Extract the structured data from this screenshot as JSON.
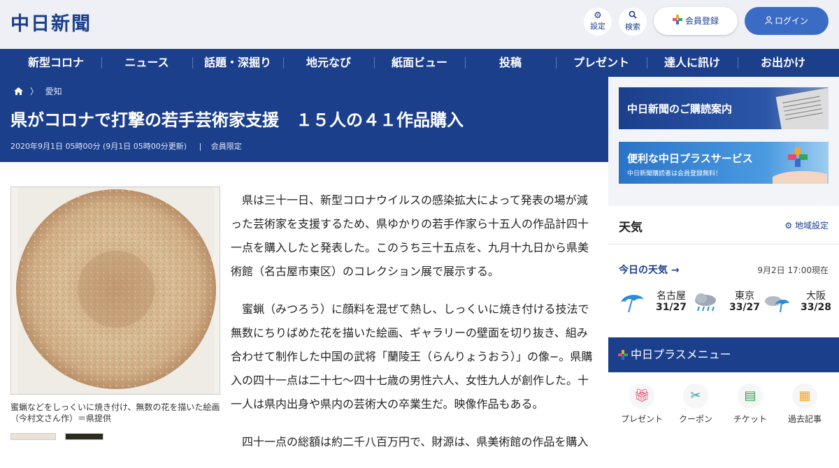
{
  "header": {
    "logo": "中日新聞",
    "settings_label": "設定",
    "search_label": "検索",
    "member_label": "会員登録",
    "login_label": "ログイン"
  },
  "nav": [
    "新型コロナ",
    "ニュース",
    "話題・深掘り",
    "地元なび",
    "紙面ビュー",
    "投稿",
    "プレゼント",
    "達人に訊け",
    "お出かけ"
  ],
  "breadcrumb": {
    "sep": "〉",
    "category": "愛知"
  },
  "article": {
    "title": "県がコロナで打撃の若手芸術家支援　１５人の４１作品購入",
    "date": "2020年9月1日 05時00分 (9月1日 05時00分更新)",
    "divider": "|",
    "access": "会員限定",
    "caption": "蜜蝋などをしっくいに焼き付け、無数の花を描いた絵画（今村文さん作）＝県提供",
    "paragraphs": [
      "県は三十一日、新型コロナウイルスの感染拡大によって発表の場が減った芸術家を支援するため、県ゆかりの若手作家ら十五人の作品計四十一点を購入したと発表した。このうち三十五点を、九月十九日から県美術館（名古屋市東区）のコレクション展で展示する。",
      "蜜蝋（みつろう）に顔料を混ぜて熱し、しっくいに焼き付ける技法で無数にちりばめた花を描いた絵画、ギャラリーの壁面を切り抜き、組み合わせて制作した中国の武将「蘭陵王（らんりょうおう）」の像−。県購入の四十一点は二十七〜四十七歳の男性六人、女性九人が創作した。十一人は県内出身や県内の芸術大の卒業生だ。映像作品もある。",
      "四十一点の総額は約二千八百万円で、財源は、県美術館の作品を購入"
    ]
  },
  "sidebar": {
    "banner1": "中日新聞のご購読案内",
    "banner2_title": "便利な中日プラスサービス",
    "banner2_sub": "中日新聞購読者は会員登録無料！",
    "weather": {
      "title": "天気",
      "region_setting": "地域設定",
      "today_label": "今日の天気",
      "arrow": "→",
      "timestamp": "9月2日 17:00現在",
      "cities": [
        {
          "name": "名古屋",
          "temp": "31/27",
          "icon": "umbrella-icon"
        },
        {
          "name": "東京",
          "temp": "33/27",
          "icon": "rain-cloud-icon"
        },
        {
          "name": "大阪",
          "temp": "33/28",
          "icon": "cloud-umbrella-icon"
        }
      ]
    },
    "plus_menu": {
      "title": "中日プラスメニュー",
      "items": [
        {
          "label": "プレゼント",
          "icon": "gift-icon"
        },
        {
          "label": "クーポン",
          "icon": "coupon-icon"
        },
        {
          "label": "チケット",
          "icon": "ticket-icon"
        },
        {
          "label": "過去記事",
          "icon": "archive-icon"
        }
      ]
    }
  },
  "colors": {
    "brand": "#1c3f8c",
    "login_button": "#3b6cc5",
    "header_bg": "#eef0f6",
    "sidebar_bg": "#f3f4f7"
  }
}
